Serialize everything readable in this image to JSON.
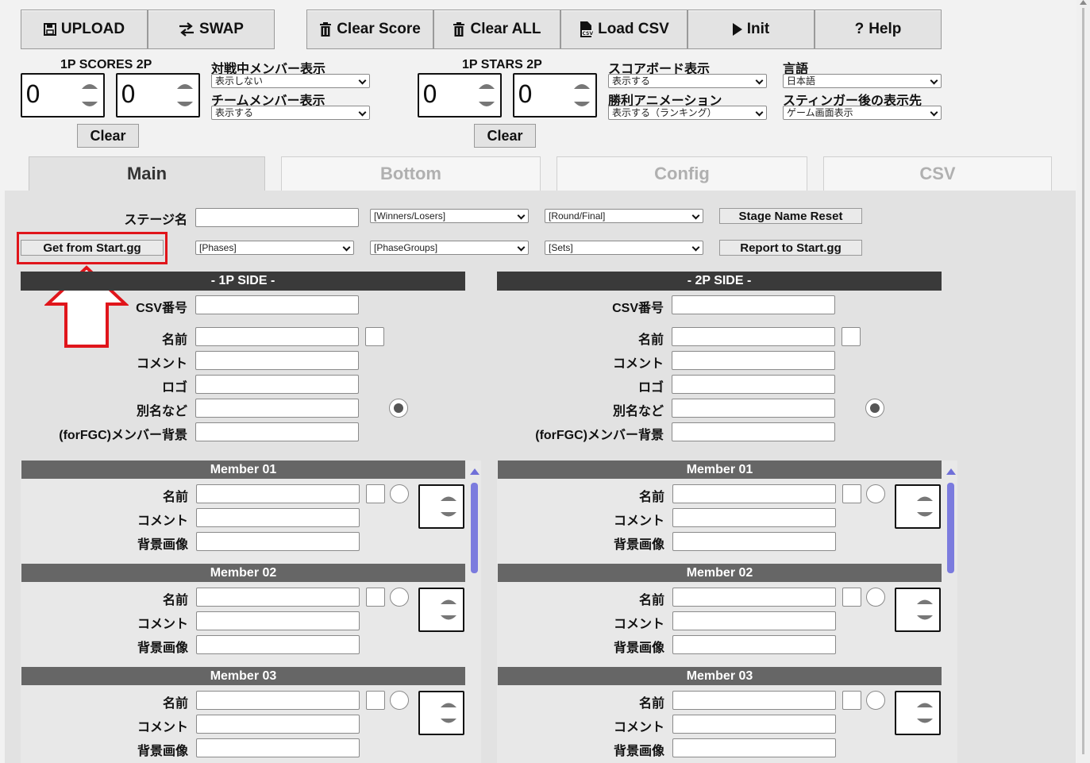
{
  "toolbar": {
    "upload": "UPLOAD",
    "swap": "SWAP",
    "clear_score": "Clear Score",
    "clear_all": "Clear ALL",
    "load_csv": "Load CSV",
    "init": "Init",
    "help": "Help"
  },
  "scores": {
    "label": "1P SCORES 2P",
    "p1": "0",
    "p2": "0",
    "clear": "Clear"
  },
  "stars": {
    "label": "1P STARS 2P",
    "p1": "0",
    "p2": "0",
    "clear": "Clear"
  },
  "settings": {
    "battle_member_label": "対戦中メンバー表示",
    "battle_member_value": "表示しない",
    "team_member_label": "チームメンバー表示",
    "team_member_value": "表示する",
    "scoreboard_label": "スコアボード表示",
    "scoreboard_value": "表示する",
    "win_anim_label": "勝利アニメーション",
    "win_anim_value": "表示する（ランキング）",
    "language_label": "言語",
    "language_value": "日本語",
    "stinger_label": "スティンガー後の表示先",
    "stinger_value": "ゲーム画面表示"
  },
  "tabs": [
    "Main",
    "Bottom",
    "Config",
    "CSV"
  ],
  "stage": {
    "label": "ステージ名",
    "winners_losers": "[Winners/Losers]",
    "round_final": "[Round/Final]",
    "reset": "Stage Name Reset",
    "get_startgg": "Get from Start.gg",
    "phases": "[Phases]",
    "phase_groups": "[PhaseGroups]",
    "sets": "[Sets]",
    "report": "Report to Start.gg"
  },
  "sides": {
    "p1_title": "- 1P SIDE -",
    "p2_title": "- 2P SIDE -",
    "csv_no": "CSV番号",
    "name": "名前",
    "comment": "コメント",
    "logo": "ロゴ",
    "alias": "別名など",
    "fgc_bg": "(forFGC)メンバー背景"
  },
  "members": {
    "titles": [
      "Member 01",
      "Member 02",
      "Member 03"
    ],
    "name": "名前",
    "comment": "コメント",
    "bg_image": "背景画像"
  },
  "colors": {
    "dark_bar": "#3a3a3a",
    "member_bar": "#666666",
    "highlight": "#e0151b",
    "scroll": "#7b7bde"
  }
}
